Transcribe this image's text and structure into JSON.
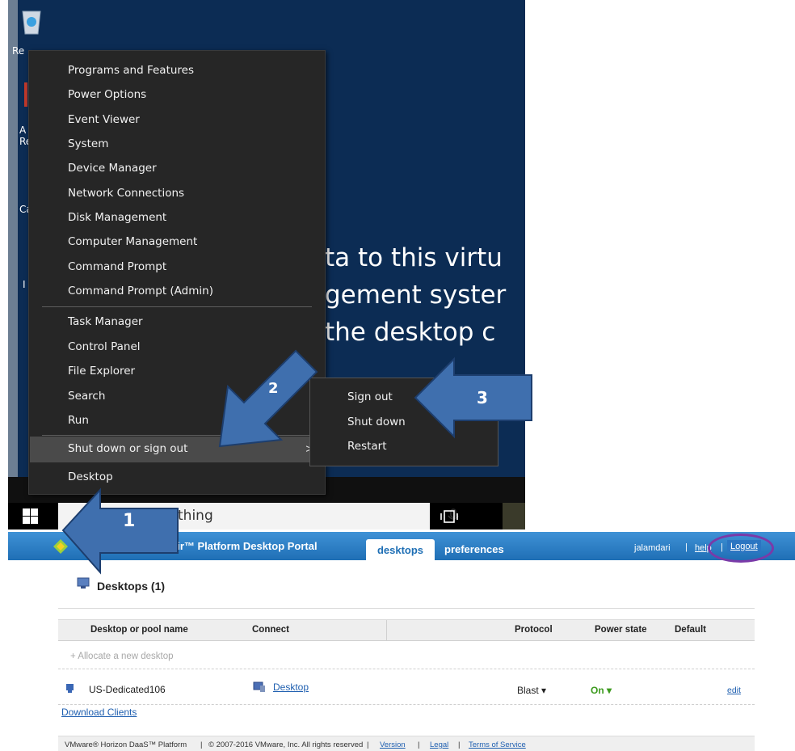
{
  "desktop": {
    "icons": [
      {
        "name": "recycle-bin",
        "label": "Re"
      },
      {
        "name": "adobe-reader",
        "label": "A Re"
      },
      {
        "name": "calculator",
        "label": "Ca"
      },
      {
        "name": "ie",
        "label": "I E"
      }
    ],
    "background_text": [
      "ta to this virtu",
      "gement syster",
      "the desktop c"
    ]
  },
  "context_menu": {
    "items": [
      "Programs and Features",
      "Power Options",
      "Event Viewer",
      "System",
      "Device Manager",
      "Network Connections",
      "Disk Management",
      "Computer Management",
      "Command Prompt",
      "Command Prompt (Admin)",
      "Task Manager",
      "Control Panel",
      "File Explorer",
      "Search",
      "Run",
      "Shut down or sign out",
      "Desktop"
    ],
    "submenu_chevron": ">"
  },
  "submenu": {
    "items": [
      "Sign out",
      "Shut down",
      "Restart"
    ]
  },
  "taskbar": {
    "search_text": "thing"
  },
  "annotations": {
    "step_1": "1",
    "step_2": "2",
    "step_3": "3",
    "arrow_color": "#3f6fae",
    "circle_color": "#7a3aa8"
  },
  "portal": {
    "title": "VMware® Horizon Air™ Platform Desktop Portal",
    "tabs": [
      "desktops",
      "preferences"
    ],
    "user": "jalamdari",
    "separator": "|",
    "help": "help",
    "logout": "Logout",
    "section_heading": "Desktops (1)",
    "table": {
      "headers": [
        "Desktop or pool name",
        "Connect",
        "Protocol",
        "Power state",
        "Default"
      ],
      "allocate": "+ Allocate a new desktop",
      "rows": [
        {
          "name": "US-Dedicated106",
          "connect": "Desktop",
          "protocol": "Blast ▾",
          "power": "On ▾",
          "action": "edit"
        }
      ]
    },
    "download": "Download Clients",
    "footer": {
      "brand": "VMware® Horizon DaaS™ Platform",
      "copyright": "© 2007-2016 VMware, Inc. All rights reserved",
      "links": [
        "Version",
        "Legal",
        "Terms of Service"
      ]
    }
  }
}
